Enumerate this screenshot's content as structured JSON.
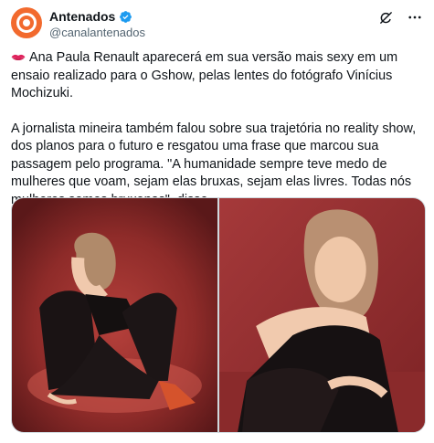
{
  "post": {
    "author": {
      "display_name": "Antenados",
      "handle": "@canalantenados",
      "verified": true,
      "avatar_color": "#f26a2e"
    },
    "paragraph_1": "Ana Paula Renault aparecerá em sua versão mais sexy em um ensaio realizado para o Gshow, pelas lentes do fotógrafo Vinícius Mochizuki.",
    "paragraph_2": "A jornalista mineira também falou sobre sua trajetória no reality show, dos planos para o futuro e resgatou uma frase que marcou sua passagem pelo programa. \"A humanidade sempre teve medo de mulheres que voam, sejam elas bruxas, sejam elas livres. Todas nós mulheres somos bruxonas\", disse.",
    "leading_icon": "lips-emoji-icon",
    "photos": [
      {
        "icon": "photo-woman-seated-red-backdrop"
      },
      {
        "icon": "photo-woman-leaning-red-backdrop"
      }
    ]
  },
  "colors": {
    "text": "#0f1419",
    "secondary": "#536471",
    "verified": "#1d9bf0",
    "backdrop": "#9b2f2c"
  }
}
